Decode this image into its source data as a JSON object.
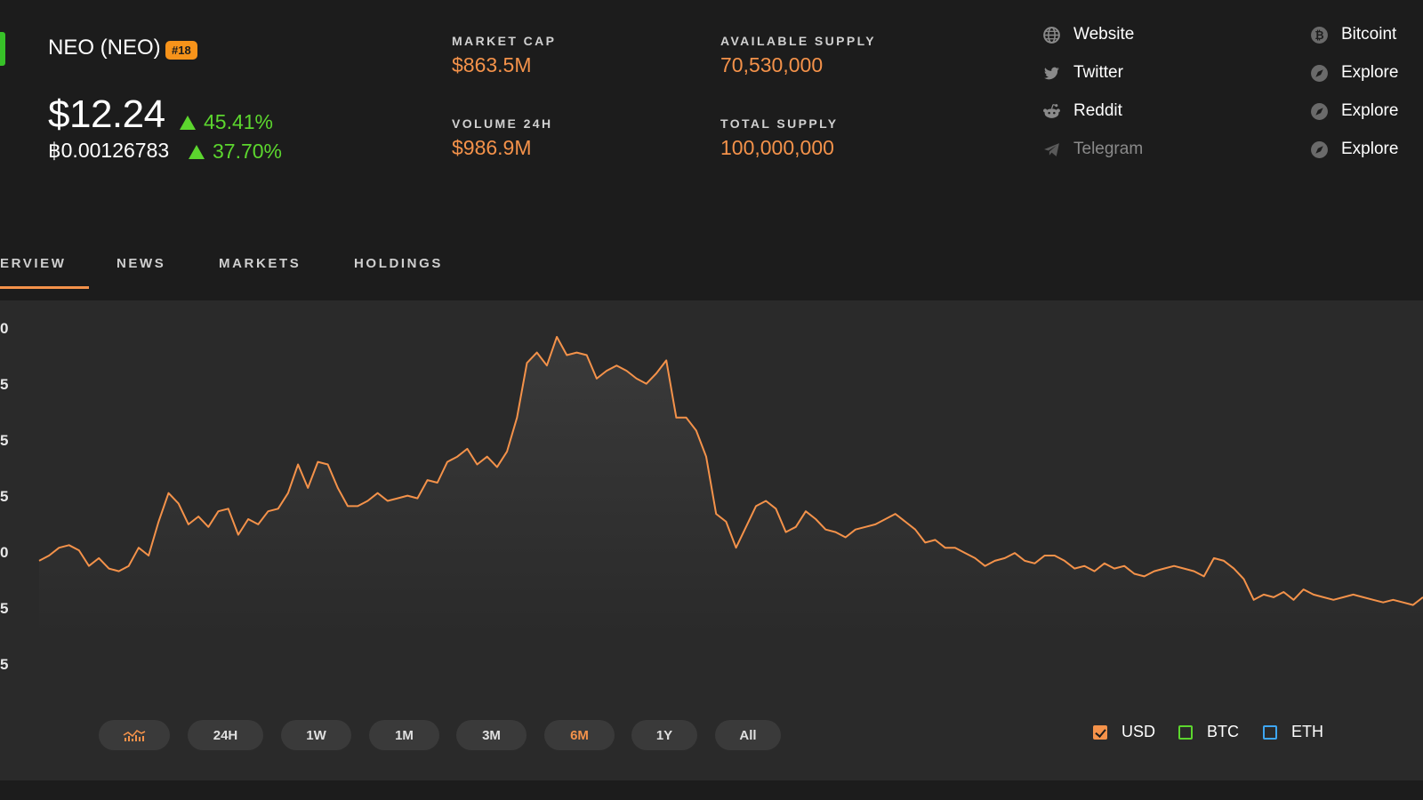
{
  "coin": {
    "name": "NEO (NEO)",
    "rank": "#18",
    "price_usd": "$12.24",
    "change_usd": "45.41%",
    "price_btc": "฿0.00126783",
    "change_btc": "37.70%",
    "logo_color": "#37c128"
  },
  "stats": {
    "market_cap_label": "MARKET CAP",
    "market_cap": "$863.5M",
    "volume_label": "VOLUME 24H",
    "volume": "$986.9M",
    "available_supply_label": "AVAILABLE SUPPLY",
    "available_supply": "70,530,000",
    "total_supply_label": "TOTAL SUPPLY",
    "total_supply": "100,000,000"
  },
  "links": [
    {
      "label": "Website",
      "icon": "globe-icon"
    },
    {
      "label": "Twitter",
      "icon": "twitter-icon"
    },
    {
      "label": "Reddit",
      "icon": "reddit-icon"
    },
    {
      "label": "Telegram",
      "icon": "telegram-icon"
    }
  ],
  "explorers": [
    {
      "label": "Bitcoint",
      "icon": "bitcoin-icon"
    },
    {
      "label": "Explore",
      "icon": "compass-icon"
    },
    {
      "label": "Explore",
      "icon": "compass-icon"
    },
    {
      "label": "Explore",
      "icon": "compass-icon"
    }
  ],
  "tabs": [
    "ERVIEW",
    "NEWS",
    "MARKETS",
    "HOLDINGS"
  ],
  "active_tab": 0,
  "range_buttons": {
    "chart_type_icon": "chart-type-icon",
    "labels": [
      "24H",
      "1W",
      "1M",
      "3M",
      "6M",
      "1Y",
      "All"
    ],
    "active": "6M"
  },
  "legend": [
    {
      "label": "USD",
      "checked": true,
      "color": "#f4924a"
    },
    {
      "label": "BTC",
      "checked": false,
      "color": "#5cd62e"
    },
    {
      "label": "ETH",
      "checked": false,
      "color": "#3ea6f2"
    }
  ],
  "colors": {
    "accent": "#f4924a",
    "positive": "#5cd62e",
    "background": "#1c1c1c",
    "panel": "#2a2a2a"
  },
  "chart_data": {
    "type": "line",
    "ytick_labels": [
      "0",
      "5",
      "5",
      "5",
      "0",
      "5",
      "5"
    ],
    "series": [
      {
        "color": "#f4924a",
        "values": [
          12.0,
          12.2,
          12.5,
          12.6,
          12.4,
          11.8,
          12.1,
          11.7,
          11.6,
          11.8,
          12.5,
          12.2,
          13.5,
          14.6,
          14.2,
          13.4,
          13.7,
          13.3,
          13.9,
          14.0,
          13.0,
          13.6,
          13.4,
          13.9,
          14.0,
          14.6,
          15.7,
          14.8,
          15.8,
          15.7,
          14.8,
          14.1,
          14.1,
          14.3,
          14.6,
          14.3,
          14.4,
          14.5,
          14.4,
          15.1,
          15.0,
          15.8,
          16.0,
          16.3,
          15.7,
          16.0,
          15.6,
          16.2,
          17.5,
          19.6,
          20.0,
          19.5,
          20.6,
          19.9,
          20.0,
          19.9,
          19.0,
          19.3,
          19.5,
          19.3,
          19.0,
          18.8,
          19.2,
          19.7,
          17.5,
          17.5,
          17.0,
          16.0,
          13.8,
          13.5,
          12.5,
          13.3,
          14.1,
          14.3,
          14.0,
          13.1,
          13.3,
          13.9,
          13.6,
          13.2,
          13.1,
          12.9,
          13.2,
          13.3,
          13.4,
          13.6,
          13.8,
          13.5,
          13.2,
          12.7,
          12.8,
          12.5,
          12.5,
          12.3,
          12.1,
          11.8,
          12.0,
          12.1,
          12.3,
          12.0,
          11.9,
          12.2,
          12.2,
          12.0,
          11.7,
          11.8,
          11.6,
          11.9,
          11.7,
          11.8,
          11.5,
          11.4,
          11.6,
          11.7,
          11.8,
          11.7,
          11.6,
          11.4,
          12.1,
          12.0,
          11.7,
          11.3,
          10.5,
          10.7,
          10.6,
          10.8,
          10.5,
          10.9,
          10.7,
          10.6,
          10.5,
          10.6,
          10.7,
          10.6,
          10.5,
          10.4,
          10.5,
          10.4,
          10.3,
          10.6
        ]
      }
    ]
  }
}
